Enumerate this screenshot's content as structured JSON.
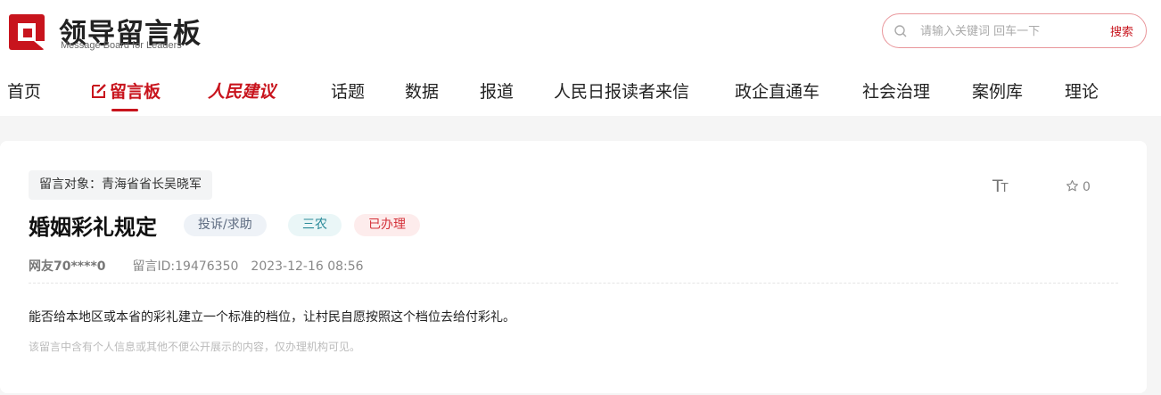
{
  "brand": {
    "title": "领导留言板",
    "subtitle": "Message Board for Leaders",
    "color": "#c8141d"
  },
  "search": {
    "placeholder": "请输入关键词 回车一下",
    "button_label": "搜索"
  },
  "nav": {
    "items": [
      {
        "label": "首页"
      },
      {
        "label": "留言板",
        "icon": "pencil-icon",
        "active": true
      },
      {
        "label": "人民建议",
        "brand": true
      },
      {
        "label": "话题"
      },
      {
        "label": "数据"
      },
      {
        "label": "报道"
      },
      {
        "label": "人民日报读者来信"
      },
      {
        "label": "政企直通车"
      },
      {
        "label": "社会治理"
      },
      {
        "label": "案例库"
      },
      {
        "label": "理论"
      }
    ]
  },
  "message": {
    "target_label": "留言对象：",
    "target_value": "青海省省长吴晓军",
    "title": "婚姻彩礼规定",
    "tags": {
      "type": "投诉/求助",
      "domain": "三农",
      "status": "已办理"
    },
    "author": "网友70****0",
    "message_id": "留言ID:19476350",
    "datetime": "2023-12-16 08:56",
    "content": "能否给本地区或本省的彩礼建立一个标准的档位，让村民自愿按照这个档位去给付彩礼。",
    "privacy_note": "该留言中含有个人信息或其他不便公开展示的内容，仅办理机构可见。",
    "favorite_count": "0",
    "font_size_icon": "font-size-icon"
  }
}
